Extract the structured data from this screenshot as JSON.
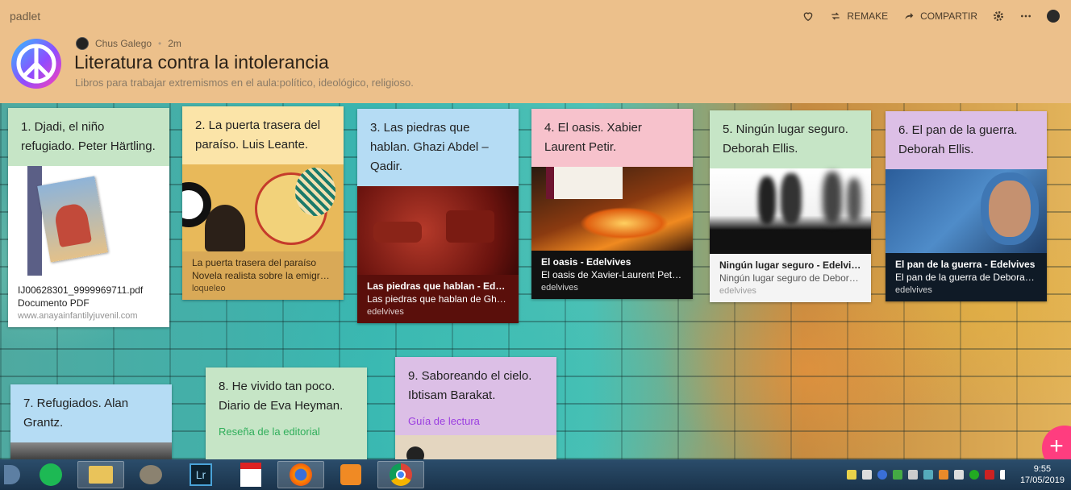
{
  "header": {
    "brand": "padlet",
    "actions": {
      "remake": "REMAKE",
      "share": "COMPARTIR"
    },
    "author": "Chus Galego",
    "time_ago": "2m",
    "title": "Literatura contra la intolerancia",
    "subtitle": "Libros para trabajar extremismos en el aula:político, ideológico, religioso."
  },
  "cards": {
    "c1": {
      "title": "1.     Djadi, el niño refugiado. Peter Härtling.",
      "file_name": "IJ00628301_9999969711.pdf",
      "file_type": "Documento PDF",
      "domain": "www.anayainfantilyjuvenil.com"
    },
    "c2": {
      "title": "2.     La puerta trasera del paraíso. Luis Leante.",
      "link_title": "La puerta trasera del paraíso",
      "link_desc": "Novela realista sobre la emigra…",
      "domain": "loqueleo"
    },
    "c3": {
      "title": "3.     Las piedras que hablan. Ghazi Abdel – Qadir.",
      "link_title": "Las piedras que hablan - Edelv…",
      "link_desc": "Las piedras que hablan de Gha…",
      "domain": "edelvives"
    },
    "c4": {
      "title": "4.     El oasis. Xabier Laurent Petir.",
      "link_title": "El oasis - Edelvives",
      "link_desc": "El oasis de Xavier-Laurent Peti…",
      "domain": "edelvives"
    },
    "c5": {
      "title": "5.     Ningún lugar seguro. Deborah Ellis.",
      "link_title": "Ningún lugar seguro - Edelvives",
      "link_desc": "Ningún lugar seguro de Debora…",
      "domain": "edelvives"
    },
    "c6": {
      "title": "6.     El pan de la guerra. Deborah Ellis.",
      "link_title": "El pan de la guerra - Edelvives",
      "link_desc": "El pan de la guerra de Deborah…",
      "domain": "edelvives"
    },
    "c7": {
      "title": "7.     Refugiados. Alan Grantz."
    },
    "c8": {
      "title": "8.     He vivido tan poco. Diario de Eva Heyman.",
      "link": "Reseña de la editorial"
    },
    "c9": {
      "title": "9.     Saboreando el cielo. Ibtisam Barakat.",
      "link": "Guía de lectura"
    }
  },
  "taskbar": {
    "time": "9:55",
    "date": "17/05/2019"
  },
  "colors": {
    "header": "#ecc08b",
    "fab": "#ff3d7f",
    "green": "#c6e5c6",
    "yellow": "#fbe4a8",
    "blue": "#b5dcf4",
    "pink": "#f7c2cc",
    "purple": "#dcbfe6"
  }
}
